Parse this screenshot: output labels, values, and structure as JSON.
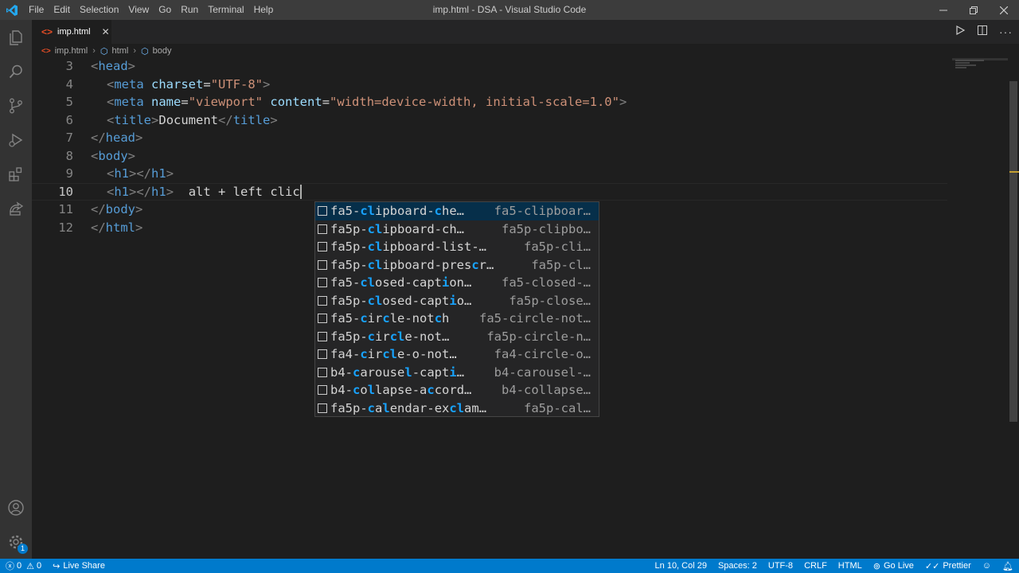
{
  "app": {
    "window_title": "imp.html - DSA - Visual Studio Code",
    "menu": [
      "File",
      "Edit",
      "Selection",
      "View",
      "Go",
      "Run",
      "Terminal",
      "Help"
    ]
  },
  "activity_bar": {
    "items": [
      "explorer-icon",
      "search-icon",
      "source-control-icon",
      "run-debug-icon",
      "extensions-icon",
      "remote-explorer-icon"
    ],
    "bottom": [
      "account-icon",
      "manage-gear-icon"
    ],
    "manage_badge": "1"
  },
  "tabs": [
    {
      "label": "imp.html",
      "icon": "html-file-icon",
      "active": true
    }
  ],
  "breadcrumb": [
    "imp.html",
    "html",
    "body"
  ],
  "editor": {
    "lines": [
      {
        "num": "3",
        "segments": [
          [
            "br",
            "<"
          ],
          [
            "tag",
            "head"
          ],
          [
            "br",
            ">"
          ]
        ],
        "indent": ""
      },
      {
        "num": "4",
        "segments": [
          [
            "br",
            "<"
          ],
          [
            "tag",
            "meta"
          ],
          [
            "txt",
            " "
          ],
          [
            "attr",
            "charset"
          ],
          [
            "txt",
            "="
          ],
          [
            "str",
            "\"UTF-8\""
          ],
          [
            "br",
            ">"
          ]
        ],
        "indent": "  "
      },
      {
        "num": "5",
        "segments": [
          [
            "br",
            "<"
          ],
          [
            "tag",
            "meta"
          ],
          [
            "txt",
            " "
          ],
          [
            "attr",
            "name"
          ],
          [
            "txt",
            "="
          ],
          [
            "str",
            "\"viewport\""
          ],
          [
            "txt",
            " "
          ],
          [
            "attr",
            "content"
          ],
          [
            "txt",
            "="
          ],
          [
            "str",
            "\"width=device-width, initial-scale=1.0\""
          ],
          [
            "br",
            ">"
          ]
        ],
        "indent": "  "
      },
      {
        "num": "6",
        "segments": [
          [
            "br",
            "<"
          ],
          [
            "tag",
            "title"
          ],
          [
            "br",
            ">"
          ],
          [
            "txt",
            "Document"
          ],
          [
            "br",
            "</"
          ],
          [
            "tag",
            "title"
          ],
          [
            "br",
            ">"
          ]
        ],
        "indent": "  "
      },
      {
        "num": "7",
        "segments": [
          [
            "br",
            "</"
          ],
          [
            "tag",
            "head"
          ],
          [
            "br",
            ">"
          ]
        ],
        "indent": ""
      },
      {
        "num": "8",
        "segments": [
          [
            "br",
            "<"
          ],
          [
            "tag",
            "body"
          ],
          [
            "br",
            ">"
          ]
        ],
        "indent": ""
      },
      {
        "num": "9",
        "segments": [
          [
            "br",
            "<"
          ],
          [
            "tag",
            "h1"
          ],
          [
            "br",
            "></"
          ],
          [
            "tag",
            "h1"
          ],
          [
            "br",
            ">"
          ]
        ],
        "indent": "  "
      },
      {
        "num": "10",
        "segments": [
          [
            "br",
            "<"
          ],
          [
            "tag",
            "h1"
          ],
          [
            "br",
            "></"
          ],
          [
            "tag",
            "h1"
          ],
          [
            "br",
            ">"
          ],
          [
            "txt",
            "  alt + left clic"
          ]
        ],
        "indent": "  ",
        "current": true
      },
      {
        "num": "11",
        "segments": [
          [
            "br",
            "</"
          ],
          [
            "tag",
            "body"
          ],
          [
            "br",
            ">"
          ]
        ],
        "indent": ""
      },
      {
        "num": "12",
        "segments": [
          [
            "br",
            "</"
          ],
          [
            "tag",
            "html"
          ],
          [
            "br",
            ">"
          ]
        ],
        "indent": ""
      }
    ]
  },
  "suggestions": [
    {
      "label": [
        [
          "",
          "fa5-"
        ],
        [
          "h",
          "cl"
        ],
        [
          "",
          "ipboard-"
        ],
        [
          "h",
          "c"
        ],
        [
          "",
          "he…"
        ]
      ],
      "detail": "fa5-clipboar…",
      "selected": true
    },
    {
      "label": [
        [
          "",
          "fa5p-"
        ],
        [
          "h",
          "cl"
        ],
        [
          "",
          "ipboard-ch…"
        ]
      ],
      "detail": "fa5p-clipbo…"
    },
    {
      "label": [
        [
          "",
          "fa5p-"
        ],
        [
          "h",
          "cl"
        ],
        [
          "",
          "ipboard-list-…"
        ]
      ],
      "detail": "fa5p-cli…"
    },
    {
      "label": [
        [
          "",
          "fa5p-"
        ],
        [
          "h",
          "cl"
        ],
        [
          "",
          "ipboard-pres"
        ],
        [
          "h",
          "c"
        ],
        [
          "",
          "r…"
        ]
      ],
      "detail": "fa5p-cl…"
    },
    {
      "label": [
        [
          "",
          "fa5-"
        ],
        [
          "h",
          "cl"
        ],
        [
          "",
          "osed-capt"
        ],
        [
          "h",
          "i"
        ],
        [
          "",
          "on…"
        ]
      ],
      "detail": "fa5-closed-…"
    },
    {
      "label": [
        [
          "",
          "fa5p-"
        ],
        [
          "h",
          "cl"
        ],
        [
          "",
          "osed-capt"
        ],
        [
          "h",
          "i"
        ],
        [
          "",
          "o…"
        ]
      ],
      "detail": "fa5p-close…"
    },
    {
      "label": [
        [
          "",
          "fa5-"
        ],
        [
          "h",
          "c"
        ],
        [
          "",
          "ir"
        ],
        [
          "h",
          "c"
        ],
        [
          "",
          "le-not"
        ],
        [
          "h",
          "c"
        ],
        [
          "",
          "h"
        ]
      ],
      "detail": "fa5-circle-not…"
    },
    {
      "label": [
        [
          "",
          "fa5p-"
        ],
        [
          "h",
          "c"
        ],
        [
          "",
          "ir"
        ],
        [
          "h",
          "cl"
        ],
        [
          "",
          "e-not…"
        ]
      ],
      "detail": "fa5p-circle-n…"
    },
    {
      "label": [
        [
          "",
          "fa4-"
        ],
        [
          "h",
          "c"
        ],
        [
          "",
          "ir"
        ],
        [
          "h",
          "cl"
        ],
        [
          "",
          "e-o-not…"
        ]
      ],
      "detail": "fa4-circle-o…"
    },
    {
      "label": [
        [
          "",
          "b4-"
        ],
        [
          "h",
          "c"
        ],
        [
          "",
          "arouse"
        ],
        [
          "h",
          "l"
        ],
        [
          "",
          "-capt"
        ],
        [
          "h",
          "i"
        ],
        [
          "",
          "…"
        ]
      ],
      "detail": "b4-carousel-…"
    },
    {
      "label": [
        [
          "",
          "b4-"
        ],
        [
          "h",
          "c"
        ],
        [
          "",
          "o"
        ],
        [
          "h",
          "l"
        ],
        [
          "",
          "lapse-a"
        ],
        [
          "h",
          "c"
        ],
        [
          "",
          "cord…"
        ]
      ],
      "detail": "b4-collapse…"
    },
    {
      "label": [
        [
          "",
          "fa5p-"
        ],
        [
          "h",
          "c"
        ],
        [
          "",
          "a"
        ],
        [
          "h",
          "l"
        ],
        [
          "",
          "endar-ex"
        ],
        [
          "h",
          "cl"
        ],
        [
          "",
          "am…"
        ]
      ],
      "detail": "fa5p-cal…"
    }
  ],
  "statusbar": {
    "errors": "0",
    "warnings": "0",
    "live_share": "Live Share",
    "position": "Ln 10, Col 29",
    "spaces": "Spaces: 2",
    "encoding": "UTF-8",
    "eol": "CRLF",
    "language": "HTML",
    "go_live": "Go Live",
    "prettier": "Prettier"
  },
  "colors": {
    "accent": "#007acc",
    "highlight": "#18a3ff",
    "selected_row": "#062f4a"
  }
}
